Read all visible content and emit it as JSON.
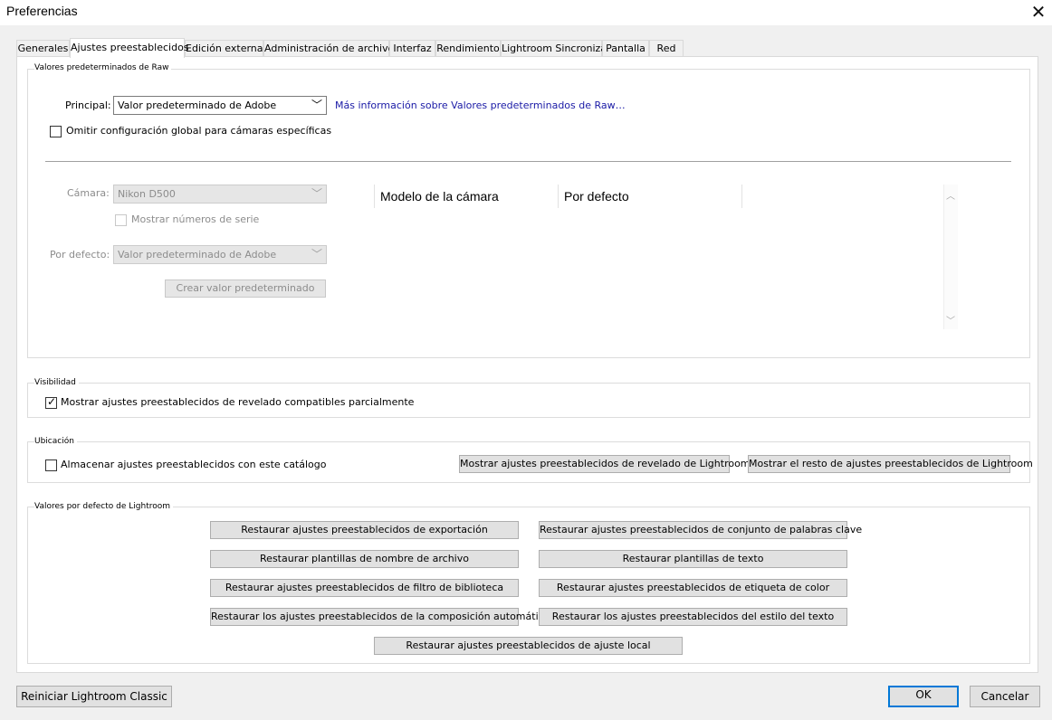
{
  "window": {
    "title": "Preferencias"
  },
  "tabs": [
    {
      "label": "Generales",
      "active": false
    },
    {
      "label": "Ajustes preestablecidos",
      "active": true
    },
    {
      "label": "Edición externa",
      "active": false
    },
    {
      "label": "Administración de archivos",
      "active": false
    },
    {
      "label": "Interfaz",
      "active": false
    },
    {
      "label": "Rendimiento",
      "active": false
    },
    {
      "label": "Lightroom Sincronizar",
      "active": false
    },
    {
      "label": "Pantalla",
      "active": false
    },
    {
      "label": "Red",
      "active": false
    }
  ],
  "raw_defaults": {
    "group_label": "Valores predeterminados de Raw",
    "principal_label": "Principal:",
    "principal_value": "Valor predeterminado de Adobe",
    "more_info_link": "Más información sobre Valores predeterminados de Raw…",
    "override_label": "Omitir configuración global para cámaras específicas",
    "override_checked": false,
    "camera_label": "Cámara:",
    "camera_value": "Nikon D500",
    "show_serial_label": "Mostrar números de serie",
    "default_label": "Por defecto:",
    "default_value": "Valor predeterminado de Adobe",
    "create_default_button": "Crear valor predeterminado",
    "table_columns": [
      "Modelo de la cámara",
      "Por defecto"
    ]
  },
  "visibility": {
    "group_label": "Visibilidad",
    "show_partial_label": "Mostrar ajustes preestablecidos de revelado compatibles parcialmente",
    "show_partial_checked": true
  },
  "location": {
    "group_label": "Ubicación",
    "store_with_catalog_label": "Almacenar ajustes preestablecidos con este catálogo",
    "store_with_catalog_checked": false,
    "show_develop_button": "Mostrar ajustes preestablecidos de revelado de Lightroom",
    "show_other_button": "Mostrar el resto de ajustes preestablecidos de Lightroom"
  },
  "lightroom_defaults": {
    "group_label": "Valores por defecto de Lightroom",
    "buttons": [
      "Restaurar ajustes preestablecidos de exportación",
      "Restaurar ajustes preestablecidos de conjunto de palabras clave",
      "Restaurar plantillas de nombre de archivo",
      "Restaurar plantillas de texto",
      "Restaurar ajustes preestablecidos de filtro de biblioteca",
      "Restaurar ajustes preestablecidos de etiqueta de color",
      "Restaurar los ajustes preestablecidos de la composición automática",
      "Restaurar los ajustes preestablecidos del estilo del texto",
      "Restaurar ajustes preestablecidos de ajuste local"
    ]
  },
  "footer": {
    "restart_button": "Reiniciar Lightroom Classic",
    "ok_button": "OK",
    "cancel_button": "Cancelar"
  },
  "colors": {
    "accent": "#0078d7",
    "link": "#1a1aa6"
  }
}
